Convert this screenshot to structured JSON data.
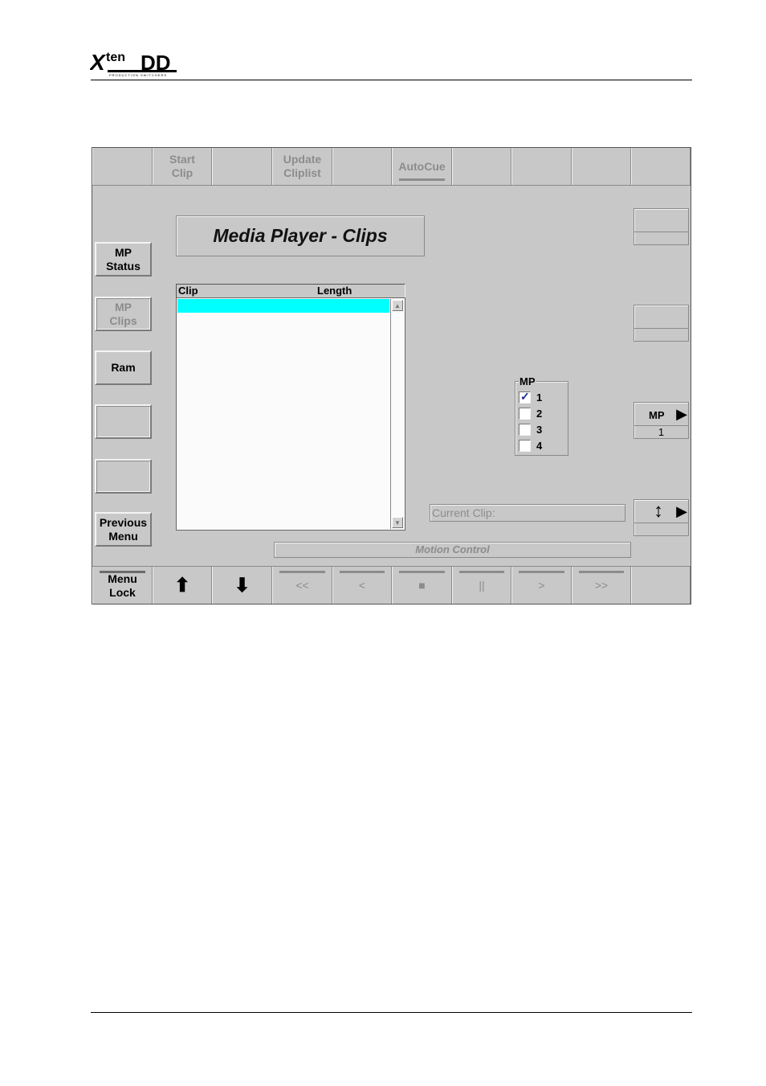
{
  "brand": {
    "logo_text": "Xten DD",
    "logo_subtext": "PRODUCTION SWITCHERS"
  },
  "top_bar": {
    "items": [
      "",
      "Start\nClip",
      "",
      "Update\nCliplist",
      "",
      "AutoCue",
      "",
      "",
      "",
      ""
    ]
  },
  "side_menu": {
    "items": [
      "MP\nStatus",
      "MP\nClips",
      "Ram",
      "",
      "",
      "Previous\nMenu"
    ]
  },
  "title": "Media Player - Clips",
  "clip_list": {
    "columns": [
      "Clip",
      "Length"
    ],
    "rows": []
  },
  "mp_group": {
    "legend": "MP",
    "options": [
      {
        "label": "1",
        "checked": true
      },
      {
        "label": "2",
        "checked": false
      },
      {
        "label": "3",
        "checked": false
      },
      {
        "label": "4",
        "checked": false
      }
    ]
  },
  "current_clip": {
    "label": "Current Clip:"
  },
  "motion_control": {
    "label": "Motion Control"
  },
  "right_panel": {
    "mp_label": "MP",
    "mp_value": "1"
  },
  "bottom_bar": {
    "items": [
      "Menu\nLock",
      "⬆",
      "⬇",
      "<<",
      "<",
      "■",
      "||",
      ">",
      ">>",
      ""
    ]
  }
}
